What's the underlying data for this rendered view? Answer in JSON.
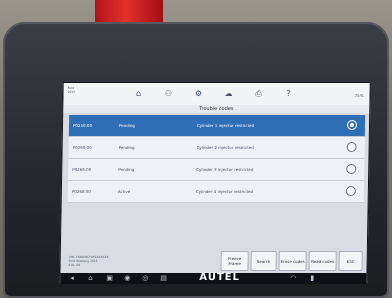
{
  "header": {
    "title": "Trouble codes",
    "vehicle_info_lines": [
      "Ford",
      "2015"
    ],
    "zoom": "75%"
  },
  "dtcs": [
    {
      "code": "P0250:00",
      "status": "Pending",
      "description": "Cylinder 1 injector restricted",
      "selected": true
    },
    {
      "code": "P0260:00",
      "status": "Pending",
      "description": "Cylinder 2 injector restricted",
      "selected": false
    },
    {
      "code": "P0266:00",
      "status": "Pending",
      "description": "Cylinder 3 injector restricted",
      "selected": false
    },
    {
      "code": "P0268:00",
      "status": "Active",
      "description": "Cylinder 4 injector restricted",
      "selected": false
    }
  ],
  "footer": {
    "info_lines": [
      "VIN: 1FA6P8CF4F5XXXXXX",
      "Ford Mustang 2015",
      "5.0L V8"
    ],
    "buttons": {
      "freeze_frame": "Freeze Frame",
      "search": "Search",
      "erase_codes": "Erase codes",
      "read_codes": "Read codes",
      "esc": "ESC"
    }
  },
  "navbar": {
    "brand": "AUTEL"
  },
  "icons": {
    "home": "home-icon",
    "vehicle": "vehicle-icon",
    "settings": "settings-icon",
    "cloud": "cloud-icon",
    "print": "print-icon",
    "help": "help-icon"
  }
}
